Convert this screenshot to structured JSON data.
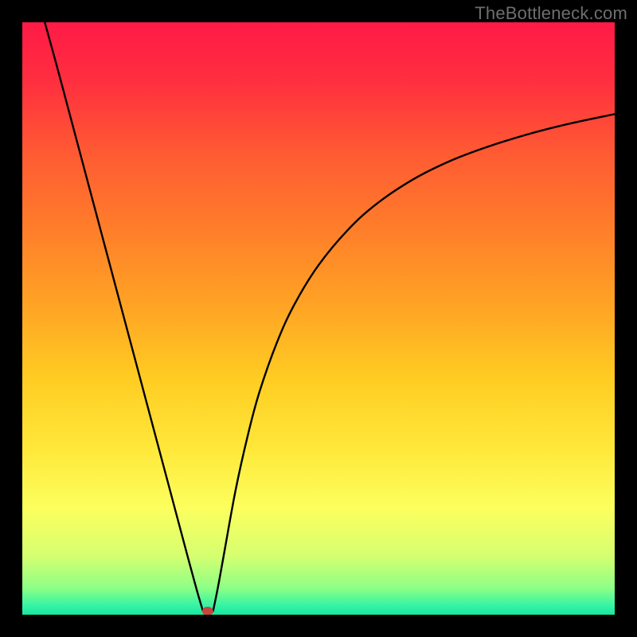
{
  "watermark": "TheBottleneck.com",
  "colors": {
    "bg": "#000000",
    "curve": "#000000",
    "marker": "#c6453e",
    "gradient_stops": [
      {
        "offset": 0.0,
        "color": "#ff1a47"
      },
      {
        "offset": 0.1,
        "color": "#ff2f3f"
      },
      {
        "offset": 0.22,
        "color": "#ff5a33"
      },
      {
        "offset": 0.35,
        "color": "#ff7e2a"
      },
      {
        "offset": 0.48,
        "color": "#ffa424"
      },
      {
        "offset": 0.6,
        "color": "#ffcc22"
      },
      {
        "offset": 0.72,
        "color": "#ffe83a"
      },
      {
        "offset": 0.82,
        "color": "#fcff5e"
      },
      {
        "offset": 0.9,
        "color": "#d6ff70"
      },
      {
        "offset": 0.955,
        "color": "#8dff86"
      },
      {
        "offset": 0.985,
        "color": "#34f4a5"
      },
      {
        "offset": 1.0,
        "color": "#17e6a0"
      }
    ]
  },
  "chart_data": {
    "type": "line",
    "title": "",
    "xlabel": "",
    "ylabel": "",
    "xlim": [
      0,
      100
    ],
    "ylim": [
      0,
      100
    ],
    "legend": false,
    "grid": false,
    "annotations": [],
    "series": [
      {
        "name": "left-branch",
        "x": [
          3.8,
          6,
          8,
          10,
          12,
          14,
          16,
          18,
          20,
          22,
          24,
          26,
          28,
          29.5,
          30.5
        ],
        "y": [
          100,
          92,
          84.5,
          77,
          69.5,
          62,
          54.5,
          47,
          39.5,
          32,
          24.5,
          17,
          9.5,
          4,
          0.6
        ]
      },
      {
        "name": "right-branch",
        "x": [
          32.2,
          33,
          34,
          36,
          38,
          40,
          43,
          46,
          50,
          55,
          60,
          66,
          72,
          78,
          85,
          92,
          100
        ],
        "y": [
          0.6,
          4.5,
          10,
          21,
          30,
          37.5,
          46,
          52.5,
          59,
          65,
          69.5,
          73.5,
          76.5,
          78.8,
          81,
          82.8,
          84.5
        ]
      }
    ],
    "marker": {
      "x": 31.3,
      "y": 0.6
    }
  }
}
